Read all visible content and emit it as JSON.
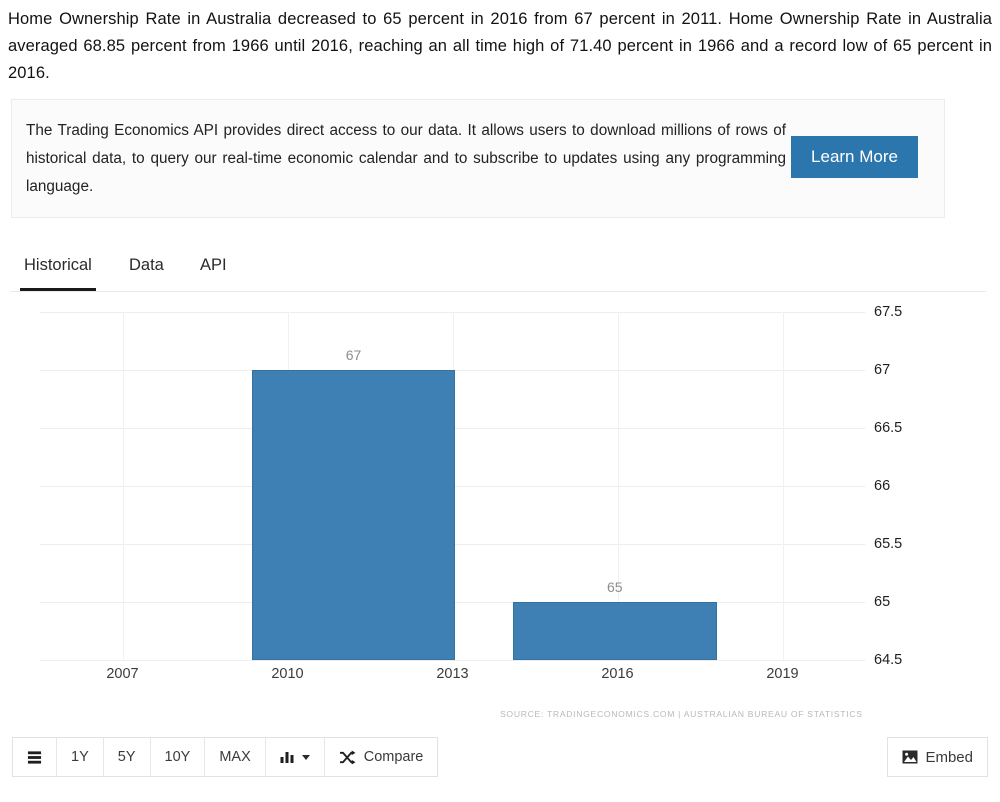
{
  "intro": {
    "paragraph": "Home Ownership Rate in Australia decreased to 65 percent in 2016 from 67 percent in 2011. Home Ownership Rate in Australia averaged 68.85 percent from 1966 until 2016, reaching an all time high of 71.40 percent in 1966 and a record low of 65 percent in 2016."
  },
  "api_promo": {
    "text": "The Trading Economics API provides direct access to our data. It allows users to download millions of rows of historical data, to query our real-time economic calendar and to subscribe to updates using any programming language.",
    "button_label": "Learn More",
    "button_color": "#2c76ae"
  },
  "tabs": [
    {
      "label": "Historical",
      "active": true
    },
    {
      "label": "Data",
      "active": false
    },
    {
      "label": "API",
      "active": false
    }
  ],
  "chart_data": {
    "type": "bar",
    "title": "",
    "xlabel": "",
    "ylabel": "",
    "categories": [
      "2011",
      "2016"
    ],
    "values": [
      67,
      65
    ],
    "data_labels": [
      "67",
      "65"
    ],
    "bar_color": "#3f80b4",
    "ylim": [
      64.5,
      67.5
    ],
    "yticks": [
      "67.5",
      "67",
      "66.5",
      "66",
      "65.5",
      "65",
      "64.5"
    ],
    "ytick_values": [
      67.5,
      67,
      66.5,
      66,
      65.5,
      65,
      64.5
    ],
    "xticks": [
      "2007",
      "2010",
      "2013",
      "2016",
      "2019"
    ],
    "xtick_values": [
      2007,
      2010,
      2013,
      2016,
      2019
    ],
    "xlim": [
      2005.5,
      2020.5
    ],
    "grid": true,
    "legend": "none",
    "source": "SOURCE: TRADINGECONOMICS.COM | AUSTRALIAN BUREAU OF STATISTICS"
  },
  "toolbar": {
    "menu_icon": "list-icon",
    "ranges": [
      "1Y",
      "5Y",
      "10Y",
      "MAX"
    ],
    "chart_type_icon": "bar-chart-icon",
    "compare_label": "Compare",
    "compare_icon": "shuffle-icon",
    "embed_label": "Embed",
    "embed_icon": "image-icon"
  }
}
